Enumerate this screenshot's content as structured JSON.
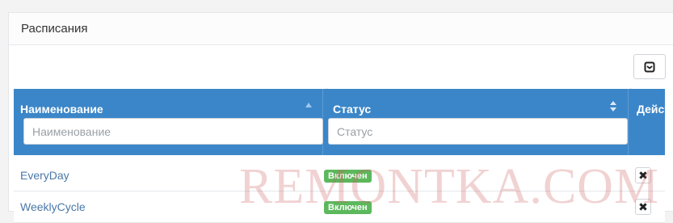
{
  "panel": {
    "title": "Расписания"
  },
  "toolbar": {
    "icon": "save-icon"
  },
  "table": {
    "headers": [
      {
        "label": "Наименование",
        "sort": "ascending"
      },
      {
        "label": "Статус",
        "sort": "both"
      },
      {
        "label": "Действ"
      }
    ],
    "filters": {
      "name_placeholder": "Наименование",
      "status_placeholder": "Статус"
    },
    "rows": [
      {
        "name": "EveryDay",
        "status": "Включен",
        "action_icon": "delete-icon"
      },
      {
        "name": "WeeklyCycle",
        "status": "Включен",
        "action_icon": "delete-icon"
      }
    ],
    "delete_glyph": "✖"
  },
  "colors": {
    "header_bg": "#3b86c8",
    "badge_bg": "#5cb85c",
    "link": "#4a78a8"
  },
  "watermark": "REMONTKA.COM"
}
